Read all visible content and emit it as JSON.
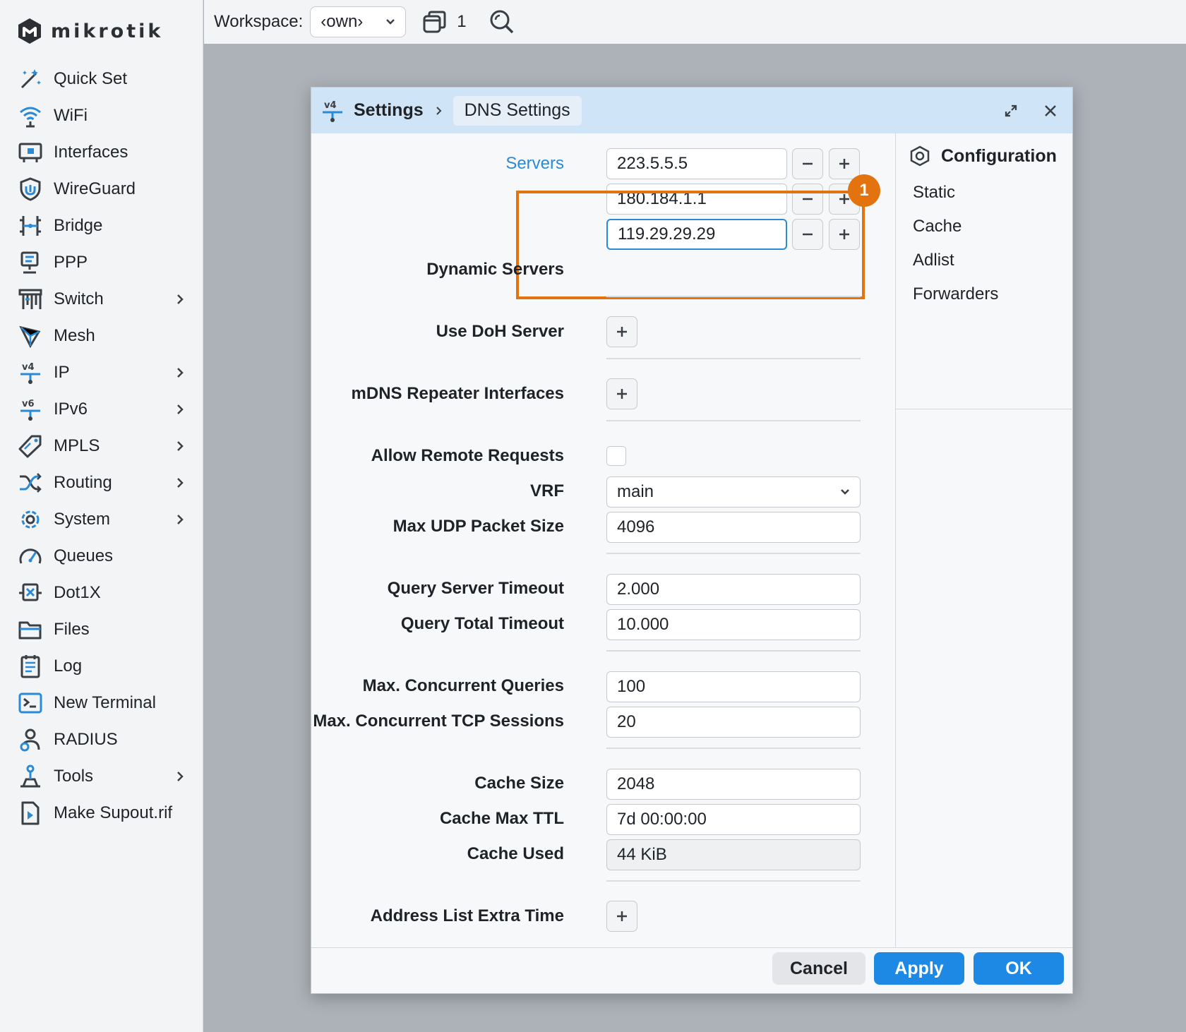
{
  "brand": {
    "name": "mikrotik"
  },
  "sidebar": {
    "items": [
      {
        "label": "Quick Set",
        "icon": "wand-icon",
        "submenu": false
      },
      {
        "label": "WiFi",
        "icon": "wifi-icon",
        "submenu": false
      },
      {
        "label": "Interfaces",
        "icon": "interfaces-icon",
        "submenu": false
      },
      {
        "label": "WireGuard",
        "icon": "wireguard-shield-icon",
        "submenu": false
      },
      {
        "label": "Bridge",
        "icon": "bridge-icon",
        "submenu": false
      },
      {
        "label": "PPP",
        "icon": "ppp-icon",
        "submenu": false
      },
      {
        "label": "Switch",
        "icon": "switch-icon",
        "submenu": true
      },
      {
        "label": "Mesh",
        "icon": "mesh-icon",
        "submenu": false
      },
      {
        "label": "IP",
        "icon": "ipv4-icon",
        "submenu": true
      },
      {
        "label": "IPv6",
        "icon": "ipv6-icon",
        "submenu": true
      },
      {
        "label": "MPLS",
        "icon": "tag-icon",
        "submenu": true
      },
      {
        "label": "Routing",
        "icon": "routing-icon",
        "submenu": true
      },
      {
        "label": "System",
        "icon": "gear-icon",
        "submenu": true
      },
      {
        "label": "Queues",
        "icon": "gauge-icon",
        "submenu": false
      },
      {
        "label": "Dot1X",
        "icon": "dot1x-icon",
        "submenu": false
      },
      {
        "label": "Files",
        "icon": "folder-icon",
        "submenu": false
      },
      {
        "label": "Log",
        "icon": "log-icon",
        "submenu": false
      },
      {
        "label": "New Terminal",
        "icon": "terminal-icon",
        "submenu": false
      },
      {
        "label": "RADIUS",
        "icon": "radius-user-icon",
        "submenu": false
      },
      {
        "label": "Tools",
        "icon": "tools-icon",
        "submenu": true
      },
      {
        "label": "Make Supout.rif",
        "icon": "supout-file-icon",
        "submenu": false
      }
    ]
  },
  "topbar": {
    "workspace_label": "Workspace:",
    "workspace_value": "‹own›",
    "window_count": "1"
  },
  "dialog": {
    "breadcrumb_root": "Settings",
    "breadcrumb_current": "DNS Settings",
    "servers_label": "Servers",
    "servers": [
      "223.5.5.5",
      "180.184.1.1",
      "119.29.29.29"
    ],
    "dynamic_servers_label": "Dynamic Servers",
    "doh_label": "Use DoH Server",
    "mdns_label": "mDNS Repeater Interfaces",
    "allow_remote_label": "Allow Remote Requests",
    "allow_remote_checked": false,
    "vrf_label": "VRF",
    "vrf_value": "main",
    "max_udp_label": "Max UDP Packet Size",
    "max_udp_value": "4096",
    "query_server_timeout_label": "Query Server Timeout",
    "query_server_timeout_value": "2.000",
    "query_total_timeout_label": "Query Total Timeout",
    "query_total_timeout_value": "10.000",
    "max_concurrent_queries_label": "Max. Concurrent Queries",
    "max_concurrent_queries_value": "100",
    "max_tcp_sessions_label": "Max. Concurrent TCP Sessions",
    "max_tcp_sessions_value": "20",
    "cache_size_label": "Cache Size",
    "cache_size_value": "2048",
    "cache_max_ttl_label": "Cache Max TTL",
    "cache_max_ttl_value": "7d 00:00:00",
    "cache_used_label": "Cache Used",
    "cache_used_value": "44 KiB",
    "address_list_extra_label": "Address List Extra Time",
    "annotation_badge": "1",
    "side_title": "Configuration",
    "side_links": [
      "Static",
      "Cache",
      "Adlist",
      "Forwarders"
    ],
    "buttons": {
      "cancel": "Cancel",
      "apply": "Apply",
      "ok": "OK"
    }
  },
  "colors": {
    "accent": "#1e88e5",
    "highlight": "#e2730f",
    "header_bg": "#cfe4f6",
    "sidebar_icon": "#2a8ad6"
  }
}
